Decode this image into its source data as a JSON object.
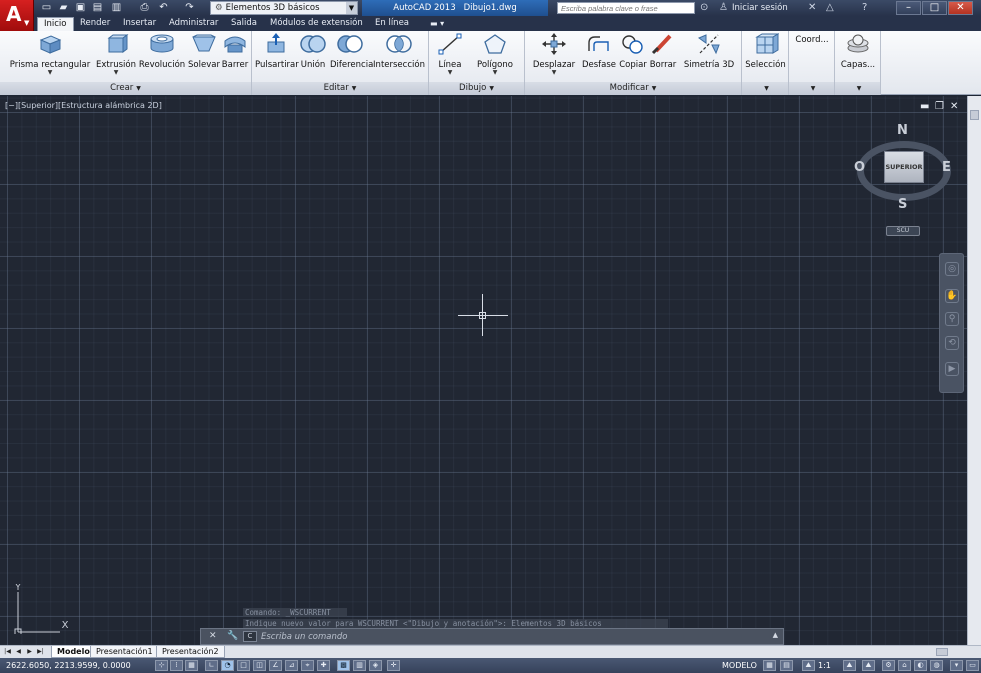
{
  "titlebar": {
    "workspace": "Elementos 3D básicos",
    "app_title": "AutoCAD 2013",
    "file_name": "Dibujo1.dwg",
    "search_placeholder": "Escriba palabra clave o frase",
    "signin": "Iniciar sesión"
  },
  "tabs": [
    {
      "label": "Inicio",
      "active": true
    },
    {
      "label": "Render"
    },
    {
      "label": "Insertar"
    },
    {
      "label": "Administrar"
    },
    {
      "label": "Salida"
    },
    {
      "label": "Módulos de extensión"
    },
    {
      "label": "En línea"
    }
  ],
  "ribbon": {
    "panels": {
      "crear": {
        "title": "Crear",
        "tools": [
          "Prisma rectangular",
          "Extrusión",
          "Revolución",
          "Solevar",
          "Barrer"
        ]
      },
      "editar": {
        "title": "Editar",
        "tools": [
          "Pulsartirar",
          "Unión",
          "Diferencia",
          "Intersección"
        ]
      },
      "dibujo": {
        "title": "Dibujo",
        "tools": [
          "Línea",
          "Polígono"
        ]
      },
      "modificar": {
        "title": "Modificar",
        "tools": [
          "Desplazar",
          "Desfase",
          "Copiar",
          "Borrar",
          "Simetría 3D"
        ]
      },
      "seleccion": {
        "tool": "Selección"
      },
      "coord": {
        "tool": "Coord..."
      },
      "capas": {
        "tool": "Capas..."
      }
    }
  },
  "viewport": {
    "controls": "[−][Superior][Estructura alámbrica 2D]",
    "viewcube": {
      "face": "SUPERIOR",
      "north": "N",
      "south": "S",
      "east": "E",
      "west": "O",
      "wcs": "SCU"
    },
    "ucs": {
      "x": "X",
      "y": "Y"
    }
  },
  "command": {
    "history": [
      "Comando: _WSCURRENT",
      "Indique nuevo valor para WSCURRENT <\"Dibujo y anotación\">: Elementos 3D básicos"
    ],
    "prompt_icon": "C",
    "placeholder": "Escriba un comando"
  },
  "layout_tabs": [
    "Modelo",
    "Presentación1",
    "Presentación2"
  ],
  "statusbar": {
    "coordinates": "2622.6050, 2213.9599, 0.0000",
    "model": "MODELO",
    "annotation_scale": "1:1"
  },
  "colors": {
    "viewport_bg": "#212733",
    "accent": "#2e6db8",
    "logo_red": "#d62020"
  }
}
